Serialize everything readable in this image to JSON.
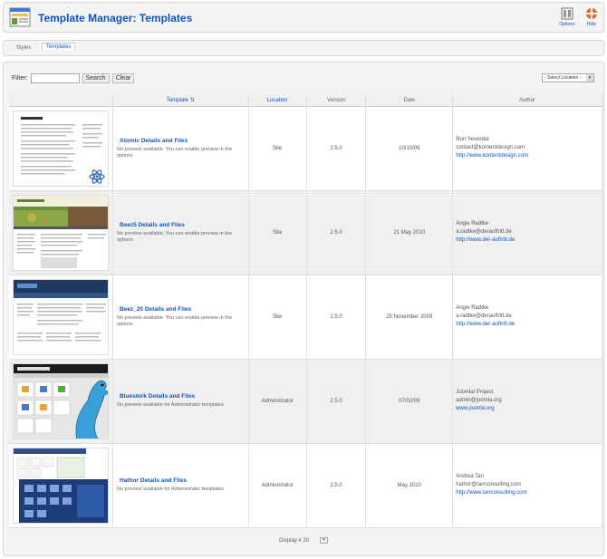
{
  "header": {
    "title": "Template Manager: Templates",
    "toolbar": [
      {
        "label": "Options",
        "icon": "options-icon"
      },
      {
        "label": "Help",
        "icon": "help-icon"
      }
    ]
  },
  "submenu": {
    "tabs": [
      {
        "label": "Styles",
        "active": false
      },
      {
        "label": "Templates",
        "active": true
      }
    ]
  },
  "filter": {
    "label": "Filter:",
    "value": "",
    "search_label": "Search",
    "clear_label": "Clear",
    "location_select": "- Select Location -"
  },
  "table": {
    "columns": {
      "template": "Template",
      "location": "Location",
      "version": "Version",
      "date": "Date",
      "author": "Author"
    },
    "rows": [
      {
        "name": "Atomic Details and Files",
        "note": "No preview available. You can enable preview in the options",
        "location": "Site",
        "version": "2.5.0",
        "date": "10/10/09",
        "author_name": "Ron Severdia",
        "author_email": "contact@kontentdesign.com",
        "author_url": "http://www.kontentdesign.com"
      },
      {
        "name": "Beez5 Details and Files",
        "note": "No preview available. You can enable preview in the options",
        "location": "Site",
        "version": "2.5.0",
        "date": "21 May 2010",
        "author_name": "Angie Radtke",
        "author_email": "a.radtke@derauftritt.de",
        "author_url": "http://www.der-auftritt.de"
      },
      {
        "name": "Beez_20 Details and Files",
        "note": "No preview available. You can enable preview in the options",
        "location": "Site",
        "version": "2.5.0",
        "date": "25 November 2009",
        "author_name": "Angie Radtke",
        "author_email": "a.radtke@derauftritt.de",
        "author_url": "http://www.der-auftritt.de"
      },
      {
        "name": "Bluestork Details and Files",
        "note": "No preview available for Administrator templates",
        "location": "Administrator",
        "version": "2.5.0",
        "date": "07/02/09",
        "author_name": "Joomla! Project",
        "author_email": "admin@joomla.org",
        "author_url": "www.joomla.org"
      },
      {
        "name": "Hathor Details and Files",
        "note": "No preview available for Administrator templates",
        "location": "Administrator",
        "version": "2.5.0",
        "date": "May 2010",
        "author_name": "Andrea Tarr",
        "author_email": "hathor@tarrconsulting.com",
        "author_url": "http://www.tarrconsulting.com"
      }
    ]
  },
  "pagination": {
    "display_label": "Display #",
    "display_value": "20"
  },
  "colors": {
    "link": "#0b55c4",
    "panel_bg": "#f4f4f4",
    "row_alt": "#f0f0f0"
  }
}
